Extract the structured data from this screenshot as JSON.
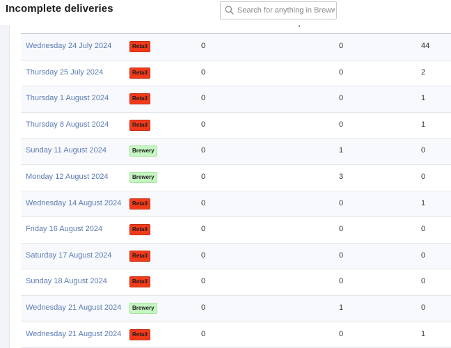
{
  "page": {
    "title": "Incomplete deliveries"
  },
  "search": {
    "placeholder": "Search for anything in Breww"
  },
  "table": {
    "rows": [
      {
        "date": "Wednesday 24 July 2024",
        "type": "Retail",
        "a": "0",
        "b": "0",
        "c": "44"
      },
      {
        "date": "Thursday 25 July 2024",
        "type": "Retail",
        "a": "0",
        "b": "0",
        "c": "2"
      },
      {
        "date": "Thursday 1 August 2024",
        "type": "Retail",
        "a": "0",
        "b": "0",
        "c": "1"
      },
      {
        "date": "Thursday 8 August 2024",
        "type": "Retail",
        "a": "0",
        "b": "0",
        "c": "1"
      },
      {
        "date": "Sunday 11 August 2024",
        "type": "Brewery",
        "a": "0",
        "b": "1",
        "c": "0"
      },
      {
        "date": "Monday 12 August 2024",
        "type": "Brewery",
        "a": "0",
        "b": "3",
        "c": "0"
      },
      {
        "date": "Wednesday 14 August 2024",
        "type": "Retail",
        "a": "0",
        "b": "0",
        "c": "1"
      },
      {
        "date": "Friday 16 August 2024",
        "type": "Retail",
        "a": "0",
        "b": "0",
        "c": "0"
      },
      {
        "date": "Saturday 17 August 2024",
        "type": "Retail",
        "a": "0",
        "b": "0",
        "c": "0"
      },
      {
        "date": "Sunday 18 August 2024",
        "type": "Retail",
        "a": "0",
        "b": "0",
        "c": "0"
      },
      {
        "date": "Wednesday 21 August 2024",
        "type": "Brewery",
        "a": "0",
        "b": "1",
        "c": "0"
      },
      {
        "date": "Wednesday 21 August 2024",
        "type": "Retail",
        "a": "0",
        "b": "0",
        "c": "1"
      }
    ]
  },
  "colors": {
    "retail_badge": "#f33b1b",
    "brewery_badge": "#c6f7c2",
    "date_link": "#5b7bb4"
  },
  "icons": {
    "search": "search-icon"
  }
}
